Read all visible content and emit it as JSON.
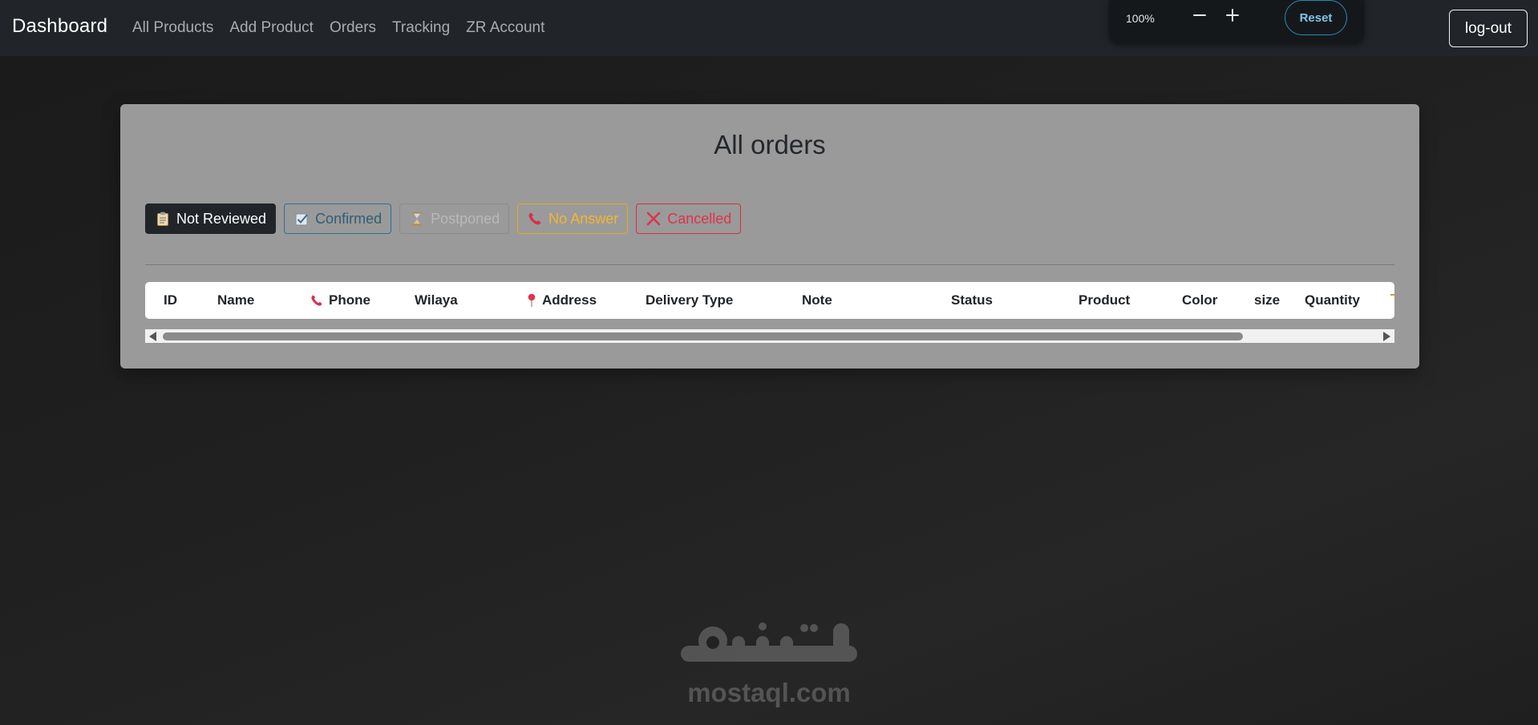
{
  "navbar": {
    "brand": "Dashboard",
    "links": [
      "All Products",
      "Add Product",
      "Orders",
      "Tracking",
      "ZR Account"
    ],
    "logout_label": "log-out"
  },
  "zoom": {
    "level": "100%",
    "reset_label": "Reset"
  },
  "orders": {
    "title": "All orders",
    "filters": [
      {
        "label": "Not Reviewed",
        "icon": "clipboard-icon"
      },
      {
        "label": "Confirmed",
        "icon": "checkbox-icon"
      },
      {
        "label": "Postponed",
        "icon": "hourglass-icon"
      },
      {
        "label": "No Answer",
        "icon": "phone-icon"
      },
      {
        "label": "Cancelled",
        "icon": "x-icon"
      }
    ],
    "columns": [
      "ID",
      "Name",
      "Phone",
      "Wilaya",
      "Address",
      "Delivery Type",
      "Note",
      "Status",
      "Product",
      "Color",
      "size",
      "Quantity"
    ],
    "column_icons": {
      "Phone": "phone-icon",
      "Address": "pin-icon"
    }
  },
  "colors": {
    "navbar": "#212529",
    "card": "#9a9a9a",
    "confirmed": "#2f6f8f",
    "no_answer": "#e5a91e",
    "cancelled": "#d92d3e",
    "reset_accent": "#2a8bb0"
  },
  "watermark": {
    "url": "mostaql.com"
  }
}
